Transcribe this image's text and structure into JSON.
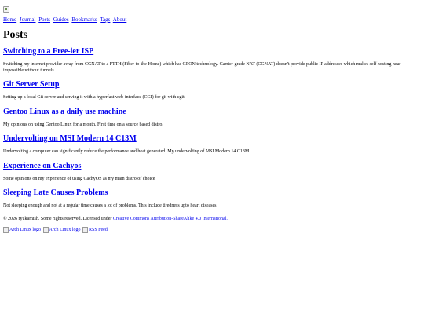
{
  "nav": {
    "items": [
      {
        "label": "Home"
      },
      {
        "label": "Journal"
      },
      {
        "label": "Posts"
      },
      {
        "label": "Guides"
      },
      {
        "label": "Bookmarks"
      },
      {
        "label": "Tags"
      },
      {
        "label": "About"
      }
    ]
  },
  "page": {
    "title": "Posts"
  },
  "posts": [
    {
      "title": "Switching to a Free-ier ISP",
      "summary": "Switching my internet provider away from CGNAT to a FTTH (Fiber-to-the-Home) which has GPON technology. Carrier-grade NAT (CGNAT) doesn't provide public IP addresses which makes self hosting near impossible without tunnels."
    },
    {
      "title": "Git Server Setup",
      "summary": "Setting up a local Git server and serving it with a hyperfast web-interface (CGI) for git with cgit."
    },
    {
      "title": "Gentoo Linux as a daily use machine",
      "summary": "My opinions on using Gentoo Linux for a month. First time on a source based distro."
    },
    {
      "title": "Undervolting on MSI Modern 14 C13M",
      "summary": "Undervolting a computer can significantly reduce the performance and heat generated. My undervolting of MSI Modern 14 C13M."
    },
    {
      "title": "Experience on Cachyos",
      "summary": "Some opinions on my experience of using CachyOS as my main distro of choice"
    },
    {
      "title": "Sleeping Late Causes Problems",
      "summary": "Not sleeping enough and not at a regular time causes a lot of problems. This include tiredness upto heart diseases."
    }
  ],
  "footer": {
    "copyright": "© 2026 ryukamish. Some rights reserved. Licensed under ",
    "license_link": "Creative Commons Attribution-ShareAlike 4.0 International."
  },
  "badges": [
    {
      "alt": "Arch Linux logo"
    },
    {
      "alt": "Arch Linux logo"
    },
    {
      "alt": "RSS Feed"
    }
  ],
  "colors": {
    "link": "#0000ee",
    "text": "#000000",
    "background": "#ffffff"
  }
}
